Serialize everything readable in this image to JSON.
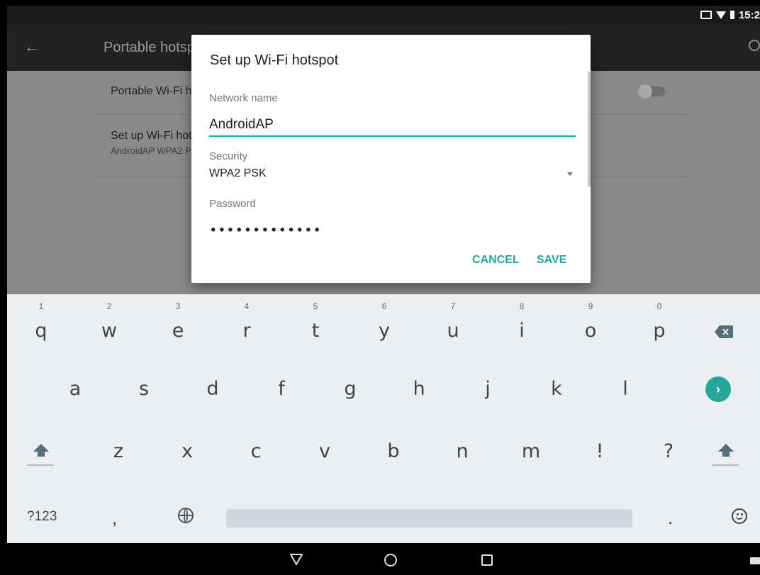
{
  "status_bar": {
    "time": "15:2"
  },
  "app_bar": {
    "title": "Portable hotspot"
  },
  "settings": {
    "wifi_hotspot_toggle_label": "Portable Wi-Fi hotspot",
    "setup_label": "Set up Wi-Fi hotspot",
    "setup_summary": "AndroidAP WPA2 PSK portable Wi-Fi hotspot"
  },
  "dialog": {
    "title": "Set up Wi-Fi hotspot",
    "network_name_label": "Network name",
    "network_name_value": "AndroidAP",
    "security_label": "Security",
    "security_value": "WPA2 PSK",
    "password_label": "Password",
    "password_value": "•••••••••••••",
    "cancel_label": "CANCEL",
    "save_label": "SAVE"
  },
  "keyboard": {
    "row1": [
      {
        "key": "q",
        "hint": "1"
      },
      {
        "key": "w",
        "hint": "2"
      },
      {
        "key": "e",
        "hint": "3"
      },
      {
        "key": "r",
        "hint": "4"
      },
      {
        "key": "t",
        "hint": "5"
      },
      {
        "key": "y",
        "hint": "6"
      },
      {
        "key": "u",
        "hint": "7"
      },
      {
        "key": "i",
        "hint": "8"
      },
      {
        "key": "o",
        "hint": "9"
      },
      {
        "key": "p",
        "hint": "0"
      }
    ],
    "row2": [
      "a",
      "s",
      "d",
      "f",
      "g",
      "h",
      "j",
      "k",
      "l"
    ],
    "row3": [
      "z",
      "x",
      "c",
      "v",
      "b",
      "n",
      "m",
      "!",
      "?"
    ],
    "symbols_label": "?123",
    "comma": ",",
    "period": ".",
    "go_glyph": "›"
  },
  "colors": {
    "accent": "#26a69a"
  },
  "icons": [
    "back-arrow-icon",
    "search-icon",
    "backspace-icon",
    "shift-icon",
    "globe-icon",
    "emoji-icon",
    "nav-back-icon",
    "nav-home-icon",
    "nav-recents-icon"
  ]
}
